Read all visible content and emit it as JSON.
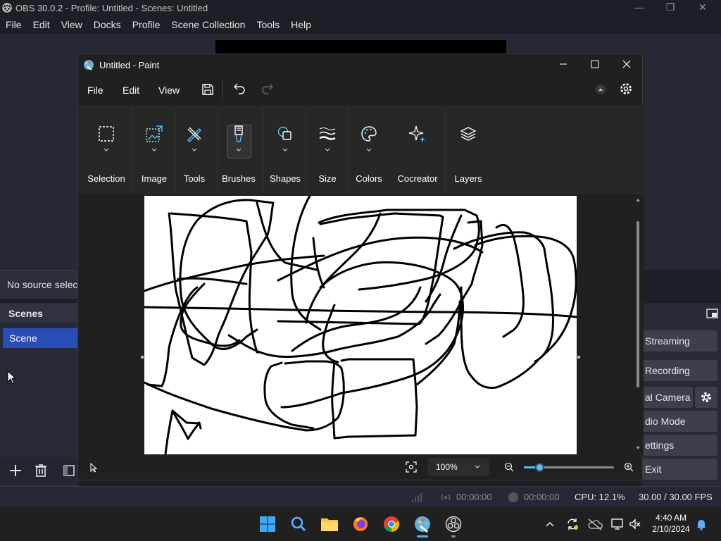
{
  "obs": {
    "title": "OBS 30.0.2 - Profile: Untitled - Scenes: Untitled",
    "menu": [
      "File",
      "Edit",
      "View",
      "Docks",
      "Profile",
      "Scene Collection",
      "Tools",
      "Help"
    ],
    "no_source": "No source selecte",
    "scenes_header": "Scenes",
    "scene_item": "Scene",
    "controls": {
      "streaming": "Streaming",
      "recording": "Recording",
      "virtual_camera": "al Camera",
      "studio_mode": "dio Mode",
      "settings": "ettings",
      "exit": "Exit"
    },
    "status": {
      "stream_time": "00:00:00",
      "rec_time": "00:00:00",
      "cpu": "CPU: 12.1%",
      "fps": "30.00 / 30.00 FPS"
    }
  },
  "paint": {
    "title": "Untitled - Paint",
    "menu": [
      "File",
      "Edit",
      "View"
    ],
    "ribbon": {
      "selection": "Selection",
      "image": "Image",
      "tools": "Tools",
      "brushes": "Brushes",
      "shapes": "Shapes",
      "size": "Size",
      "colors": "Colors",
      "cocreator": "Cocreator",
      "layers": "Layers"
    },
    "zoom": "100%",
    "zoom_slider_value": 0.17
  },
  "taskbar": {
    "time": "4:40 AM",
    "date": "2/10/2024"
  },
  "colors": {
    "accent_blue": "#284cb8",
    "paint_accent": "#4cc2ff"
  }
}
